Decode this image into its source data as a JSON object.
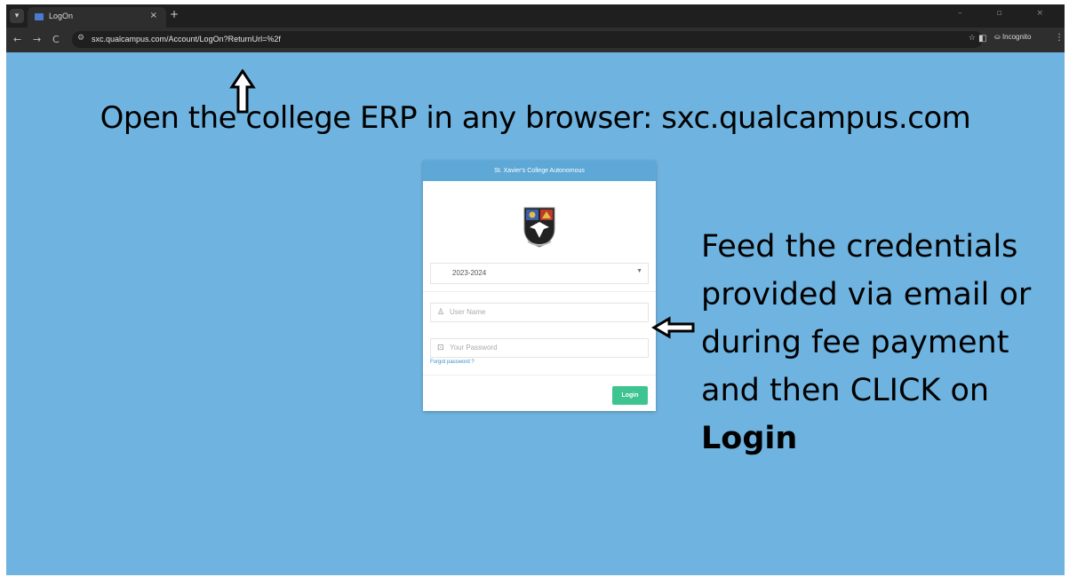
{
  "browser": {
    "tab_title": "LogOn",
    "tab_close": "×",
    "new_tab": "+",
    "window_controls": "–  ▫  ×",
    "nav_back": "←",
    "nav_forward": "→",
    "nav_reload": "C",
    "url": "sxc.qualcampus.com/Account/LogOn?ReturnUrl=%2f",
    "incognito_label": "Incognito"
  },
  "annotations": {
    "headline": "Open the college ERP in any browser: sxc.qualcampus.com",
    "side_note_lines": [
      "Feed the credentials",
      "provided via email or",
      "during fee payment",
      "and then CLICK on"
    ],
    "side_note_bold": "Login"
  },
  "login_card": {
    "header": "St. Xavier's College Autonomous",
    "year_selected": "2023-2024",
    "username_placeholder": "User Name",
    "password_placeholder": "Your Password",
    "forgot_password": "Forgot password ?",
    "login_button": "Login"
  },
  "colors": {
    "background": "#6fb4e0",
    "card_header": "#5da8d6",
    "login_button": "#3ec490"
  }
}
